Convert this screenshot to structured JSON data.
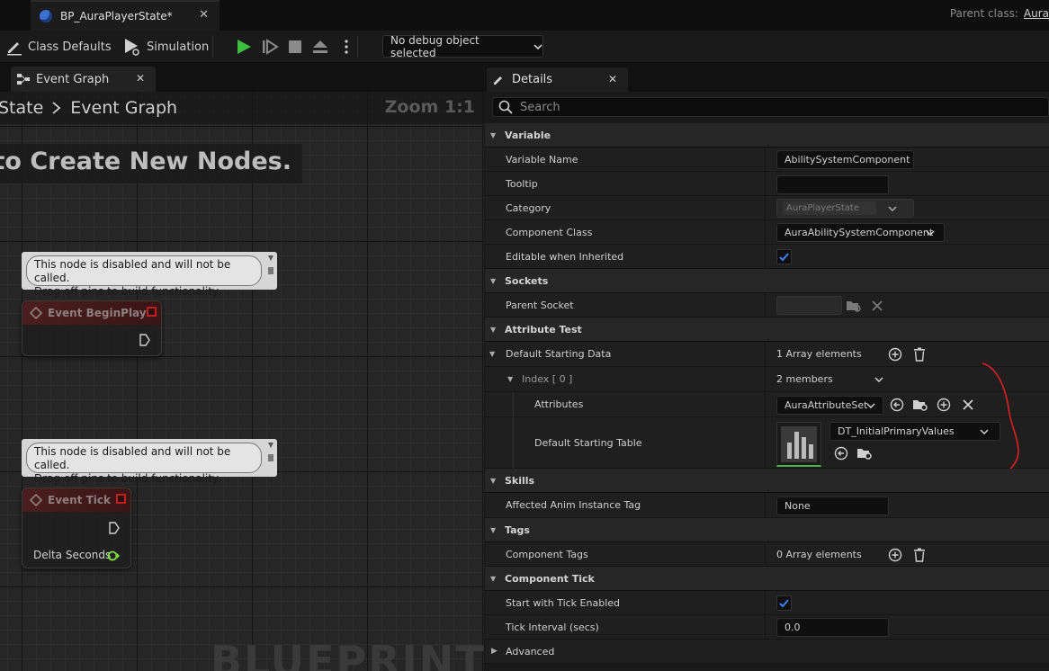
{
  "window": {
    "document_tab": "BP_AuraPlayerState*",
    "parent_class_label": "Parent class:",
    "parent_class_value": "Aura"
  },
  "toolbar": {
    "class_defaults": "Class Defaults",
    "simulation": "Simulation",
    "debug_object": "No debug object selected"
  },
  "graph": {
    "tab": "Event Graph",
    "breadcrumb_parent": "State",
    "breadcrumb_current": "Event Graph",
    "zoom": "Zoom 1:1",
    "create_hint": "Right-Click to Create New Nodes.",
    "comment_line1": "This node is disabled and will not be called.",
    "comment_line2": "Drag off pins to build functionality.",
    "node_begin_play": "Event BeginPlay",
    "node_tick": "Event Tick",
    "pin_delta_seconds": "Delta Seconds",
    "watermark": "BLUEPRINT"
  },
  "details": {
    "tab": "Details",
    "search_placeholder": "Search",
    "categories": {
      "variable": "Variable",
      "sockets": "Sockets",
      "attribute_test": "Attribute Test",
      "skills": "Skills",
      "tags": "Tags",
      "component_tick": "Component Tick",
      "advanced": "Advanced"
    },
    "rows": {
      "variable_name_label": "Variable Name",
      "variable_name_value": "AbilitySystemComponent",
      "tooltip_label": "Tooltip",
      "tooltip_value": "",
      "category_label": "Category",
      "category_value": "AuraPlayerState",
      "component_class_label": "Component Class",
      "component_class_value": "AuraAbilitySystemComponent",
      "editable_inherited_label": "Editable when Inherited",
      "parent_socket_label": "Parent Socket",
      "default_starting_data_label": "Default Starting Data",
      "default_starting_data_value": "1 Array elements",
      "index_label": "Index [ 0 ]",
      "index_value": "2 members",
      "attributes_label": "Attributes",
      "attributes_value": "AuraAttributeSet",
      "default_starting_table_label": "Default Starting Table",
      "default_starting_table_value": "DT_InitialPrimaryValues",
      "affected_anim_label": "Affected Anim Instance Tag",
      "affected_anim_value": "None",
      "component_tags_label": "Component Tags",
      "component_tags_value": "0 Array elements",
      "start_tick_label": "Start with Tick Enabled",
      "tick_interval_label": "Tick Interval (secs)",
      "tick_interval_value": "0.0"
    },
    "checkbox_color": "#3b82f6",
    "annotation_color": "#e02020"
  }
}
